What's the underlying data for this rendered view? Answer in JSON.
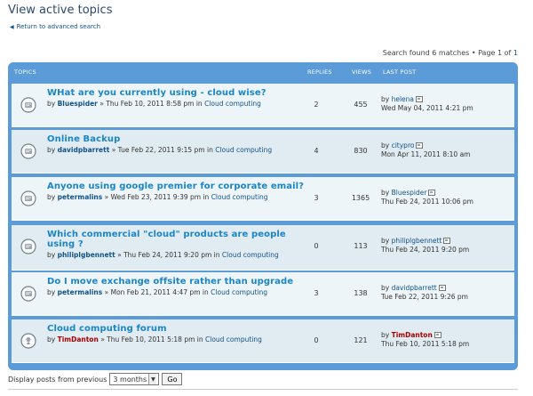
{
  "page": {
    "title": "View active topics",
    "back_link": "Return to advanced search",
    "search_meta_prefix": "Search found 6 matches • Page ",
    "page_current": "1",
    "page_of": " of ",
    "page_total": "1"
  },
  "table": {
    "headers": {
      "topics": "Topics",
      "replies": "Replies",
      "views": "Views",
      "last_post": "Last post"
    },
    "rows": [
      {
        "title": "WHat are you currently using - cloud wise?",
        "by": "by",
        "author": "Bluespider",
        "date": " » Thu Feb 10, 2011 8:58 pm in ",
        "forum": "Cloud computing",
        "replies": "2",
        "views": "455",
        "lp_by": "by",
        "lp_author": "helena",
        "lp_date": "Wed May 04, 2011 4:21 pm",
        "icon": "topic-read-icon"
      },
      {
        "title": "Online Backup",
        "by": "by",
        "author": "davidpbarrett",
        "date": " » Tue Feb 22, 2011 9:15 pm in ",
        "forum": "Cloud computing",
        "replies": "4",
        "views": "830",
        "lp_by": "by",
        "lp_author": "citypro",
        "lp_date": "Mon Apr 11, 2011 8:10 am",
        "icon": "topic-read-icon"
      },
      {
        "title": "Anyone using google premier for corporate email?",
        "by": "by",
        "author": "petermalins",
        "date": " » Wed Feb 23, 2011 9:39 pm in ",
        "forum": "Cloud computing",
        "replies": "3",
        "views": "1365",
        "lp_by": "by",
        "lp_author": "Bluespider",
        "lp_date": "Thu Feb 24, 2011 10:06 pm",
        "icon": "topic-read-icon"
      },
      {
        "title": "Which commercial \"cloud\" products are people using ?",
        "by": "by",
        "author": "philiplgbennett",
        "date": " » Thu Feb 24, 2011 9:20 pm in ",
        "forum": "Cloud computing",
        "replies": "0",
        "views": "113",
        "lp_by": "by",
        "lp_author": "philiplgbennett",
        "lp_date": "Thu Feb 24, 2011 9:20 pm",
        "icon": "topic-read-icon"
      },
      {
        "title": "Do I move exchange offsite rather than upgrade",
        "by": "by",
        "author": "petermalins",
        "date": " » Mon Feb 21, 2011 4:47 pm in ",
        "forum": "Cloud computing",
        "replies": "3",
        "views": "138",
        "lp_by": "by",
        "lp_author": "davidpbarrett",
        "lp_date": "Tue Feb 22, 2011 9:26 pm",
        "icon": "topic-read-icon"
      },
      {
        "title": "Cloud computing forum",
        "by": "by",
        "author": "TimDanton",
        "date": " » Thu Feb 10, 2011 5:18 pm in ",
        "forum": "Cloud computing",
        "replies": "0",
        "views": "121",
        "lp_by": "by",
        "lp_author": "TimDanton",
        "lp_date": "Thu Feb 10, 2011 5:18 pm",
        "icon": "announcement-icon"
      }
    ]
  },
  "display": {
    "label": "Display posts from previous",
    "selected": "3 months",
    "go": "Go"
  },
  "colors": {
    "header_blue": "#5b9bd8",
    "link": "#1a85c7",
    "admin": "#aa0000"
  }
}
